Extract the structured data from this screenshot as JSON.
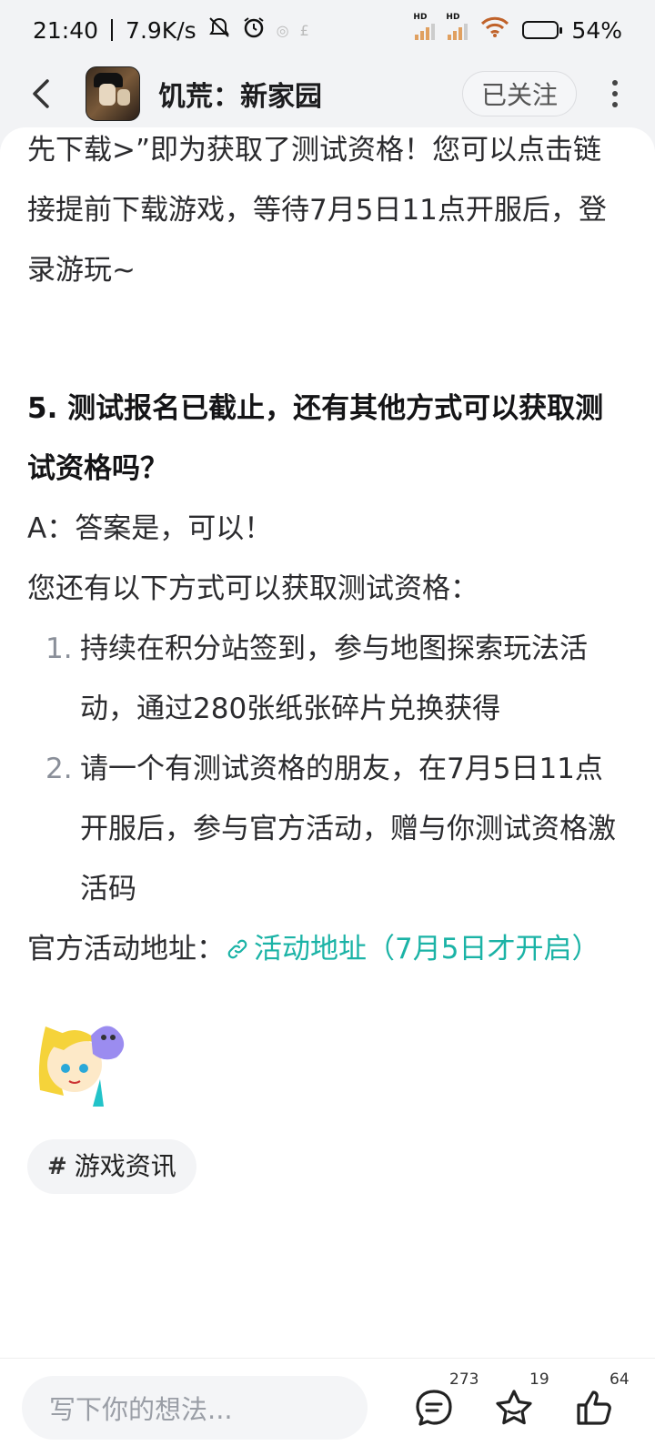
{
  "status_bar": {
    "time": "21:40",
    "speed": "7.9K/s",
    "hd1": "HD",
    "hd2": "HD",
    "battery": "54%",
    "battery_level": 0.54
  },
  "header": {
    "title": "饥荒：新家园",
    "follow_label": "已关注"
  },
  "article": {
    "para_top": "先下载>”即为获取了测试资格！您可以点击链接提前下载游戏，等待7月5日11点开服后，登录游玩~",
    "question": "5. 测试报名已截止，还有其他方式可以获取测试资格吗？",
    "answer": "A：答案是，可以！",
    "intro": "您还有以下方式可以获取测试资格：",
    "items": [
      {
        "num": "1.",
        "text": "持续在积分站签到，参与地图探索玩法活动，通过280张纸张碎片兑换获得"
      },
      {
        "num": "2.",
        "text": "请一个有测试资格的朋友，在7月5日11点开服后，参与官方活动，赠与你测试资格激活码"
      }
    ],
    "address_label": "官方活动地址：",
    "link_text": "活动地址（7月5日才开启）",
    "topic": "游戏资讯",
    "topic_hash": "#"
  },
  "bottom": {
    "placeholder": "写下你的想法...",
    "comments": "273",
    "favorites": "19",
    "likes": "64"
  }
}
